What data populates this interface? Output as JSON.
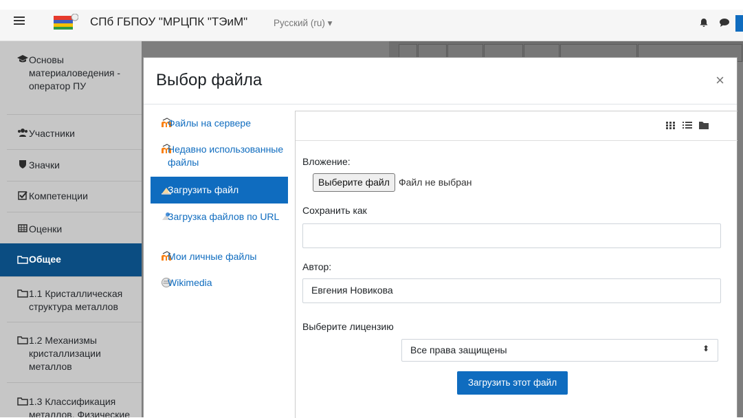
{
  "header": {
    "background_text": "",
    "site_name": "СПб ГБПОУ \"МРЦПК \"ТЭиМ\"",
    "language": "Русский (ru) ▾",
    "icons": [
      "menu-icon",
      "bell-icon",
      "chat-icon"
    ]
  },
  "drawer": {
    "items": [
      {
        "label": "Основы материаловедения - оператор ПУ",
        "icon": "graduation-cap-icon"
      },
      {
        "label": "Участники",
        "icon": "users-icon"
      },
      {
        "label": "Значки",
        "icon": "shield-icon"
      },
      {
        "label": "Компетенции",
        "icon": "checkbox-icon"
      },
      {
        "label": "Оценки",
        "icon": "table-icon"
      },
      {
        "label": "Общее",
        "icon": "folder-icon",
        "active": true
      },
      {
        "label": "1.1 Кристаллическая структура металлов",
        "icon": "folder-icon"
      },
      {
        "label": "1.2 Механизмы кристаллизации металлов",
        "icon": "folder-icon"
      },
      {
        "label": "1.3 Классификация металлов. Физические",
        "icon": "folder-icon"
      }
    ]
  },
  "modal": {
    "title": "Выбор файла",
    "close": "×",
    "repositories": [
      {
        "label": "Файлы на сервере",
        "icon": "moodle-icon"
      },
      {
        "label": "Недавно использованные файлы",
        "icon": "moodle-icon"
      },
      {
        "label": "Загрузить файл",
        "icon": "upload-icon",
        "active": true
      },
      {
        "label": "Загрузка файлов по URL",
        "icon": "url-icon"
      },
      {
        "label": "Мои личные файлы",
        "icon": "moodle-icon"
      },
      {
        "label": "Wikimedia",
        "icon": "wikimedia-icon"
      }
    ],
    "view_buttons": [
      "grid-view-icon",
      "list-view-icon",
      "folder-view-icon"
    ],
    "form": {
      "attachment_label": "Вложение:",
      "choose_file_button": "Выберите файл",
      "no_file": "Файл не выбран",
      "save_as_label": "Сохранить как",
      "save_as_value": "",
      "author_label": "Автор:",
      "author_value": "Евгения Новикова",
      "license_label": "Выберите лицензию",
      "license_value": "Все права защищены",
      "submit_button": "Загрузить этот файл"
    }
  },
  "colors": {
    "primary": "#0f6cbf",
    "drawer_active": "#0b4d82",
    "backdrop": "#7e7e7e"
  }
}
